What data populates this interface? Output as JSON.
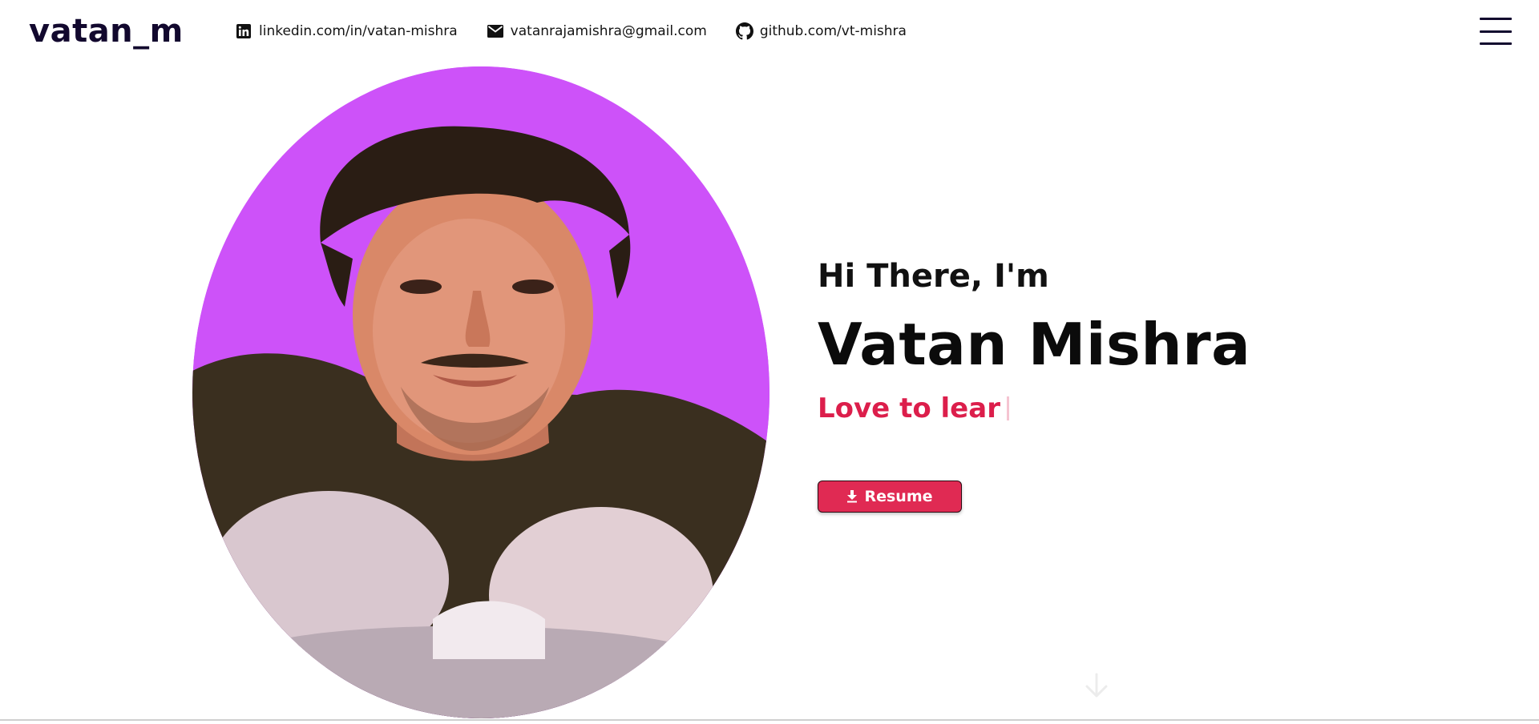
{
  "header": {
    "logo": "vatan_m",
    "contacts": [
      {
        "icon": "linkedin-icon",
        "text": "linkedin.com/in/vatan-mishra"
      },
      {
        "icon": "mail-icon",
        "text": "vatanrajamishra@gmail.com"
      },
      {
        "icon": "github-icon",
        "text": "github.com/vt-mishra"
      }
    ],
    "menu_icon": "hamburger-menu-icon"
  },
  "hero": {
    "greeting": "Hi There, I'm",
    "name": "Vatan Mishra",
    "tagline": "Love to lear",
    "resume_label": "Resume",
    "resume_icon": "download-icon",
    "scroll_icon": "arrow-down-icon"
  },
  "colors": {
    "logo": "#12082e",
    "accent": "#dc1e4b",
    "button": "#e02a53",
    "portrait_bg": "#cd52f9"
  }
}
